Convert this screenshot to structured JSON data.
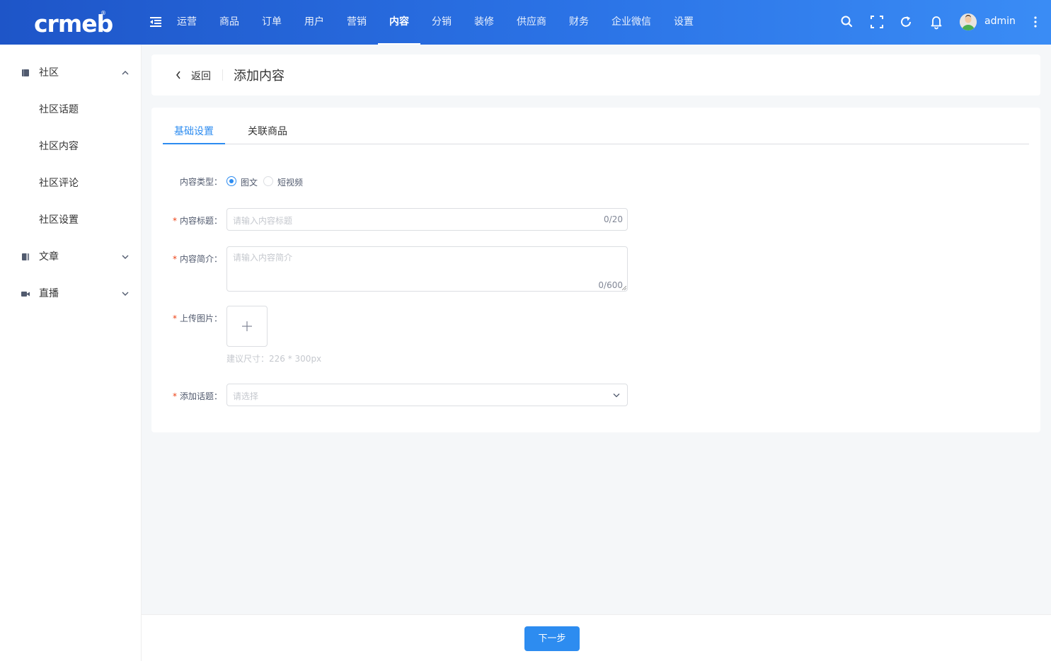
{
  "header": {
    "logo": "crmeb",
    "logo_mark": "®",
    "nav": [
      "运营",
      "商品",
      "订单",
      "用户",
      "营销",
      "内容",
      "分销",
      "装修",
      "供应商",
      "财务",
      "企业微信",
      "设置"
    ],
    "active_nav_index": 5,
    "username": "admin"
  },
  "sidebar": {
    "groups": [
      {
        "label": "社区",
        "icon": "book-icon",
        "expanded": true,
        "items": [
          "社区话题",
          "社区内容",
          "社区评论",
          "社区设置"
        ]
      },
      {
        "label": "文章",
        "icon": "article-icon",
        "expanded": false
      },
      {
        "label": "直播",
        "icon": "video-camera-icon",
        "expanded": false
      }
    ]
  },
  "page": {
    "back_label": "返回",
    "title": "添加内容"
  },
  "tabs": [
    "基础设置",
    "关联商品"
  ],
  "form": {
    "content_type": {
      "label": "内容类型：",
      "options": [
        "图文",
        "短视频"
      ],
      "selected": "图文"
    },
    "title": {
      "label": "内容标题：",
      "placeholder": "请输入内容标题",
      "counter": "0/20"
    },
    "summary": {
      "label": "内容简介：",
      "placeholder": "请输入内容简介",
      "counter": "0/600"
    },
    "image": {
      "label": "上传图片：",
      "hint": "建议尺寸：226 * 300px"
    },
    "topic": {
      "label": "添加话题：",
      "placeholder": "请选择"
    },
    "required_mark": "*"
  },
  "footer": {
    "next_label": "下一步"
  },
  "colors": {
    "primary": "#2d8cf0",
    "header_start": "#1e55c8",
    "header_end": "#3a8cf5",
    "required": "#ed4014"
  }
}
